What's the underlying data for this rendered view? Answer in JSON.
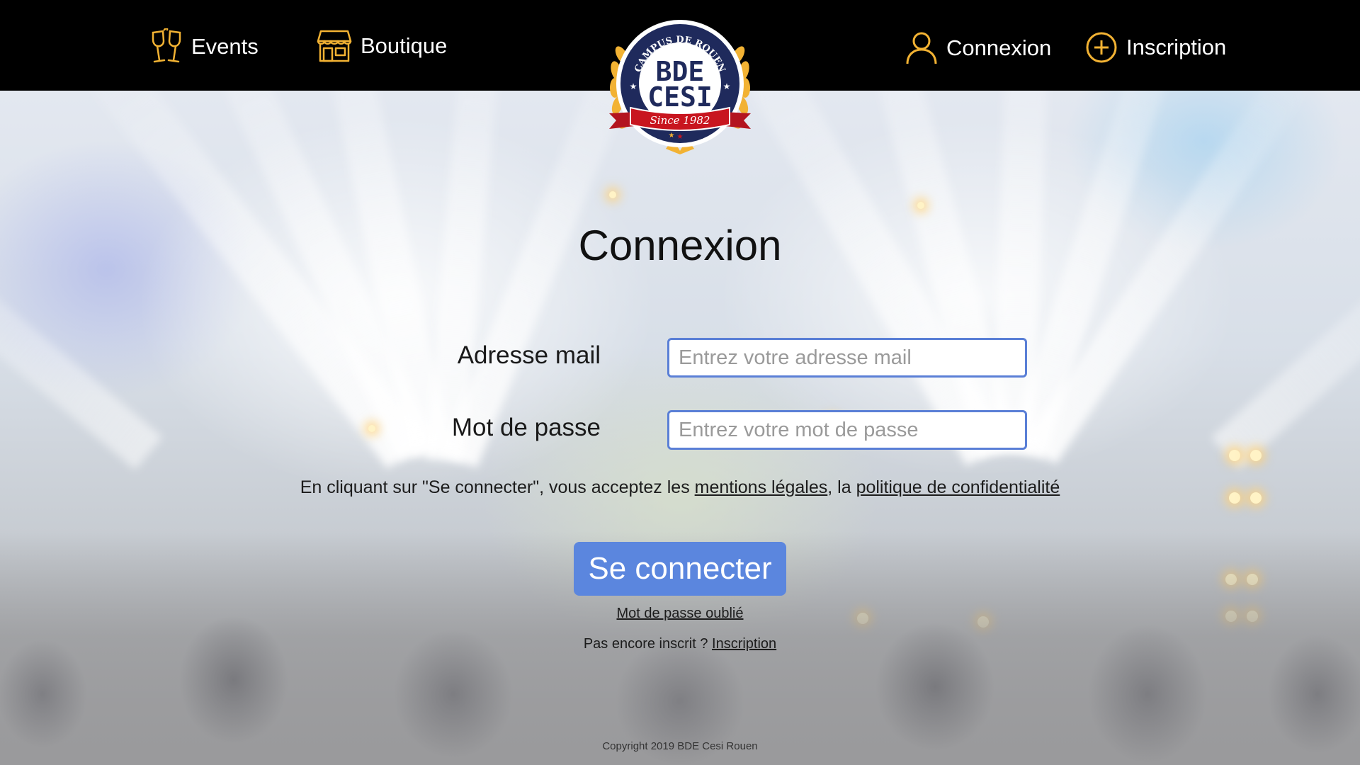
{
  "colors": {
    "header_bg": "#000000",
    "icon_accent": "#f2b233",
    "input_border": "#5a7fd6",
    "button_bg": "#5b86de"
  },
  "nav": {
    "events": {
      "label": "Events",
      "icon": "champagne-glasses-icon"
    },
    "boutique": {
      "label": "Boutique",
      "icon": "storefront-icon"
    },
    "connexion": {
      "label": "Connexion",
      "icon": "user-icon"
    },
    "inscription": {
      "label": "Inscription",
      "icon": "plus-circle-icon"
    }
  },
  "logo": {
    "ring_text": "CAMPUS DE ROUEN",
    "line1": "BDE",
    "line2": "CESI",
    "ribbon": "Since 1982"
  },
  "form": {
    "title": "Connexion",
    "email_label": "Adresse mail",
    "email_placeholder": "Entrez votre adresse mail",
    "password_label": "Mot de passe",
    "password_placeholder": "Entrez votre mot de passe",
    "terms_prefix": "En cliquant sur \"Se connecter\", vous acceptez les ",
    "terms_link1": "mentions légales",
    "terms_middle": ", la ",
    "terms_link2": "politique de confidentialité",
    "submit_label": "Se connecter",
    "forgot_label": "Mot de passe oublié",
    "signup_prefix": "Pas encore inscrit ? ",
    "signup_link": "Inscription"
  },
  "footer": {
    "copyright": "Copyright 2019 BDE Cesi Rouen"
  }
}
